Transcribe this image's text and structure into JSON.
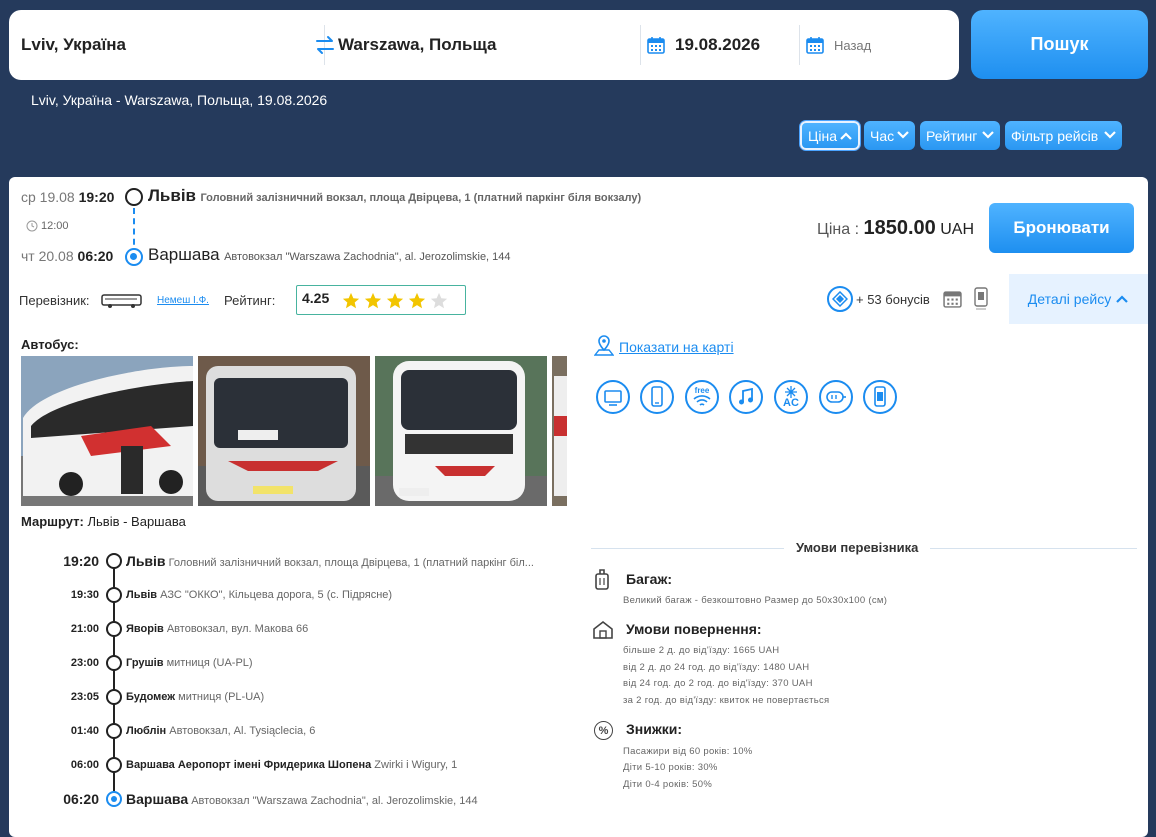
{
  "search": {
    "from": "Lviv, Україна",
    "to": "Warszawa, Польща",
    "date": "19.08.2026",
    "return_placeholder": "Назад",
    "button": "Пошук"
  },
  "summary": "Lviv, Україна - Warszawa, Польща, 19.08.2026",
  "sort": {
    "price": "Ціна",
    "time": "Час",
    "rating": "Рейтинг",
    "filter": "Фільтр рейсів"
  },
  "trip": {
    "dep_day": "ср 19.08",
    "dep_time": "19:20",
    "dep_city": "Львів",
    "dep_addr": "Головний залізничний вокзал, площа Двірцева, 1 (платний паркінг біля вокзалу)",
    "duration": "12:00",
    "arr_day": "чт 20.08",
    "arr_time": "06:20",
    "arr_city": "Варшава",
    "arr_addr": "Автовокзал \"Warszawa Zachodnia\", al. Jerozolimskie, 144",
    "price_label": "Ціна :",
    "price_value": "1850.00",
    "currency": "UAH",
    "book_button": "Бронювати",
    "carrier_label": "Перевізник:",
    "carrier_name": "Немеш І.Ф.",
    "rating_label": "Рейтинг:",
    "rating_value": "4.25",
    "rating_stars": 4.25,
    "bonus": "+ 53 бонусів",
    "details_button": "Деталі рейсу"
  },
  "bus": {
    "label": "Автобус:",
    "map_link": "Показати на карті",
    "amenity_icons": [
      "tv-icon",
      "phone-icon",
      "wifi-icon",
      "music-icon",
      "ac-icon",
      "socket-icon",
      "ticket-icon"
    ],
    "amenity_wifi": "free",
    "amenity_ac": "AC"
  },
  "route": {
    "label": "Маршрут:",
    "value": "Львів - Варшава",
    "stops": [
      {
        "time": "19:20",
        "city": "Львів",
        "addr": "Головний залізничний вокзал, площа Двірцева, 1 (платний паркінг біл..."
      },
      {
        "time": "19:30",
        "city": "Львів",
        "addr": "АЗС \"ОККО\", Кільцева дорога, 5 (с. Підрясне)"
      },
      {
        "time": "21:00",
        "city": "Яворів",
        "addr": "Автовокзал, вул. Макова 66"
      },
      {
        "time": "23:00",
        "city": "Грушів",
        "addr": "митниця (UA-PL)"
      },
      {
        "time": "23:05",
        "city": "Будомеж",
        "addr": "митниця (PL-UA)"
      },
      {
        "time": "01:40",
        "city": "Люблін",
        "addr": "Автовокзал, Al. Tysiąclecia, 6"
      },
      {
        "time": "06:00",
        "city": "Варшава Аеропорт імені Фридерика Шопена",
        "addr": "Zwirki i Wigury, 1"
      },
      {
        "time": "06:20",
        "city": "Варшава",
        "addr": "Автовокзал \"Warszawa Zachodnia\", al. Jerozolimskie, 144"
      }
    ]
  },
  "conditions": {
    "title": "Умови перевізника",
    "baggage_title": "Багаж:",
    "baggage_text": "Великий багаж - безкоштовно Размер до 50x30x100 (см)",
    "refund_title": "Умови повернення:",
    "refund_lines": [
      "більше 2 д. до від'їзду: 1665 UAH",
      "від 2 д. до 24 год. до від'їзду: 1480 UAH",
      "від 24 год. до 2 год. до від'їзду: 370 UAH",
      "за 2 год. до від'їзду: квиток не повертається"
    ],
    "discount_title": "Знижки:",
    "discount_lines": [
      "Пасажири від 60 років: 10%",
      "Діти 5-10 років: 30%",
      "Діти 0-4 років: 50%"
    ]
  },
  "colors": {
    "accent": "#1b8cf0",
    "background": "#253a5c",
    "star": "#f2c500"
  }
}
